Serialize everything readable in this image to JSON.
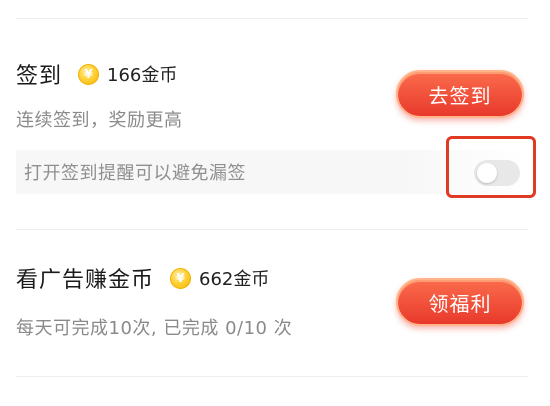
{
  "checkin": {
    "title": "签到",
    "coin_symbol": "¥",
    "reward": "166金币",
    "subtitle": "连续签到，奖励更高",
    "reminder_text": "打开签到提醒可以避免漏签",
    "reminder_enabled": false,
    "button_label": "去签到"
  },
  "ad_task": {
    "title": "看广告赚金币",
    "coin_symbol": "¥",
    "reward": "662金币",
    "subtitle": "每天可完成10次, 已完成 0/10 次",
    "button_label": "领福利"
  },
  "colors": {
    "accent_red": "#e8392c",
    "highlight_red": "#e03a24",
    "coin_gold": "#ffd23b"
  }
}
